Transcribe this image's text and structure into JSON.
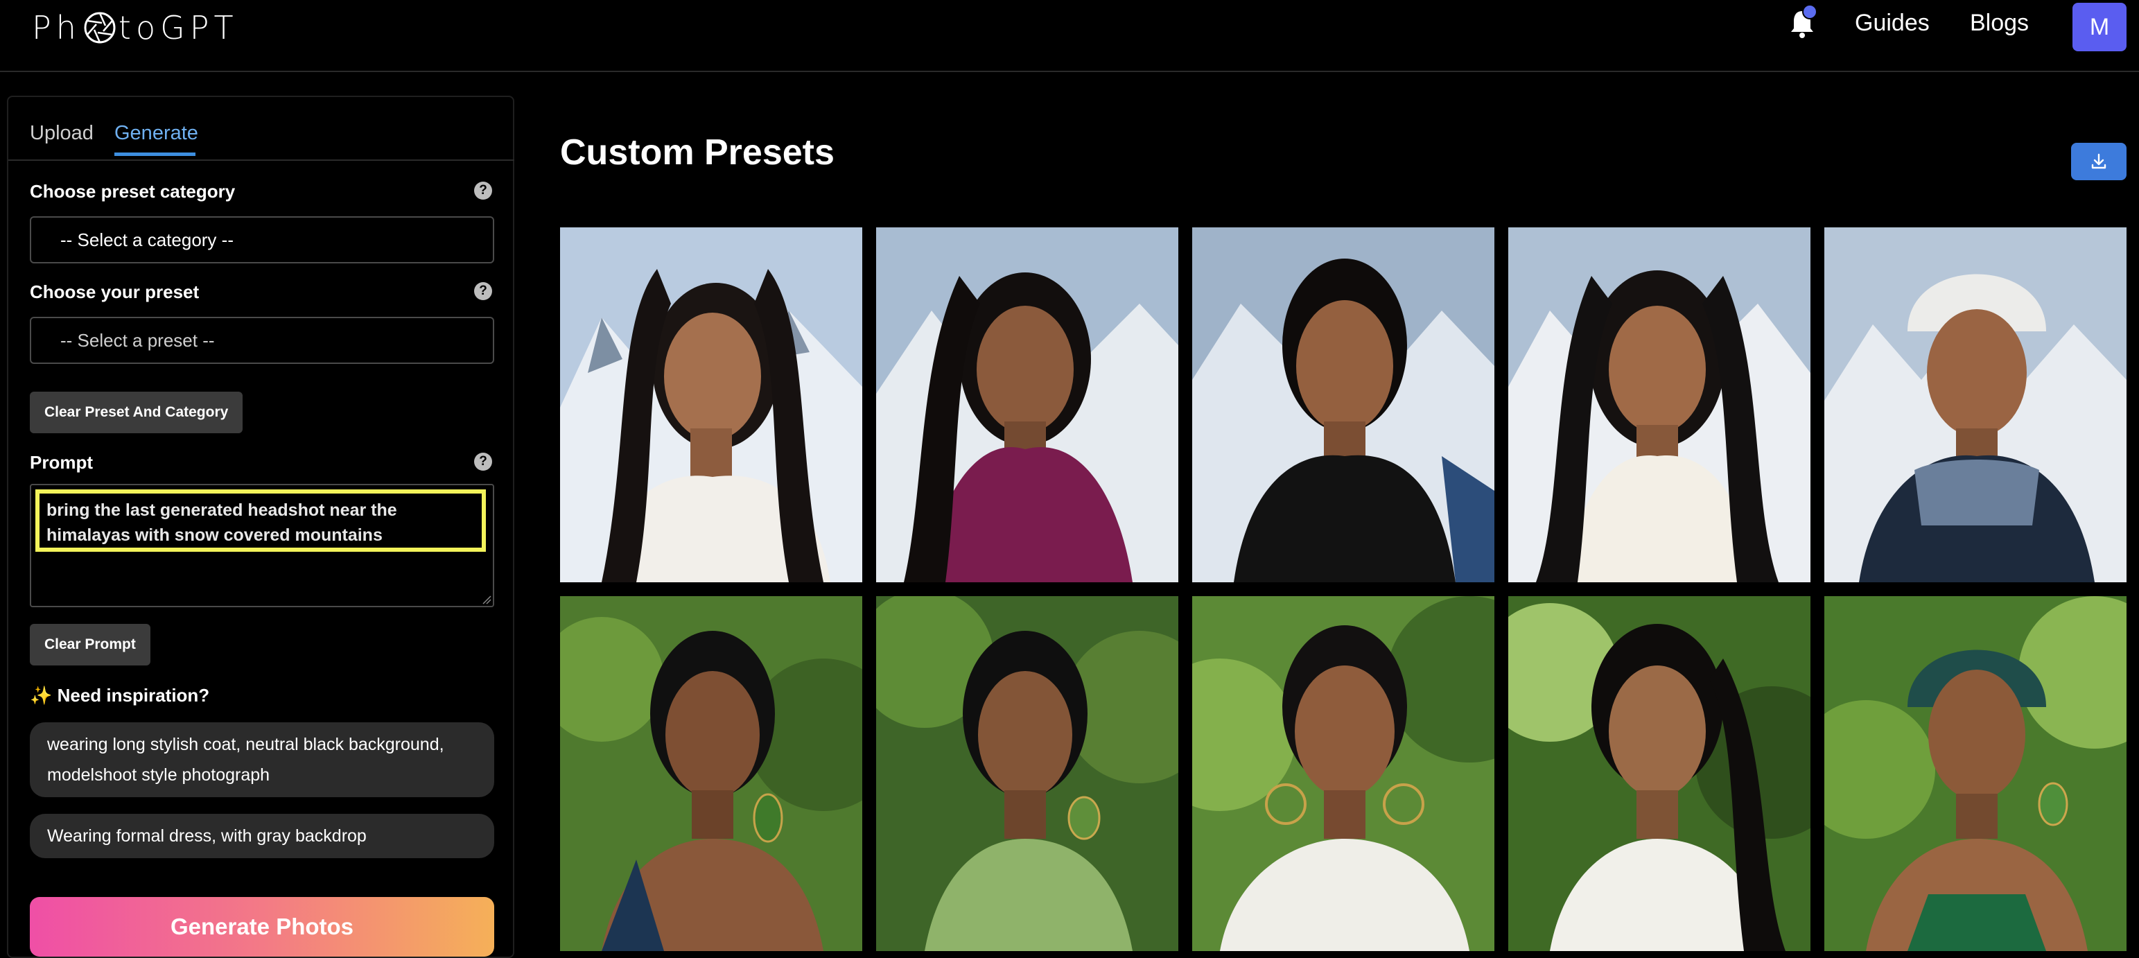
{
  "header": {
    "logo_prefix": "Ph",
    "logo_suffix": "toGPT",
    "nav": {
      "guides": "Guides",
      "blogs": "Blogs"
    },
    "avatar_initial": "M",
    "notification_icon": "bell-icon"
  },
  "sidebar": {
    "tabs": [
      {
        "label": "Upload"
      },
      {
        "label": "Generate"
      }
    ],
    "active_tab": "Generate",
    "preset_category": {
      "label": "Choose preset category",
      "value": "-- Select a category --"
    },
    "preset": {
      "label": "Choose your preset",
      "value": "-- Select a preset --"
    },
    "clear_preset_label": "Clear Preset And Category",
    "prompt": {
      "label": "Prompt",
      "value": "bring the last generated headshot near the himalayas with snow covered mountains"
    },
    "clear_prompt_label": "Clear Prompt",
    "inspiration": {
      "title": "Need inspiration?",
      "icon": "sparkles-icon",
      "suggestions": [
        "wearing long stylish coat, neutral black background, modelshoot style photograph",
        "Wearing formal dress, with gray backdrop"
      ]
    },
    "generate_label": "Generate Photos"
  },
  "main": {
    "title": "Custom Presets",
    "download_icon": "download-icon",
    "photos": [
      {
        "scene": "snow-mountain",
        "outfit": "white fur coat"
      },
      {
        "scene": "snow-mountain",
        "outfit": "magenta scarf"
      },
      {
        "scene": "snow-mountain",
        "outfit": "black scarf"
      },
      {
        "scene": "snow-mountain",
        "outfit": "white knit scarf"
      },
      {
        "scene": "snow-mountain",
        "outfit": "white beanie, blue jacket"
      },
      {
        "scene": "green-garden",
        "outfit": "green earrings"
      },
      {
        "scene": "green-garden",
        "outfit": "green top"
      },
      {
        "scene": "green-garden",
        "outfit": "white wrap, gold hoops"
      },
      {
        "scene": "green-garden",
        "outfit": "white top"
      },
      {
        "scene": "green-garden",
        "outfit": "teal headwrap"
      }
    ]
  },
  "colors": {
    "accent": "#3d7bdc",
    "active_tab": "#6fb0f0",
    "highlight": "#f3f35a",
    "avatar": "#5a5df0",
    "generate_gradient_start": "#ef4fa6",
    "generate_gradient_end": "#f5b058"
  }
}
